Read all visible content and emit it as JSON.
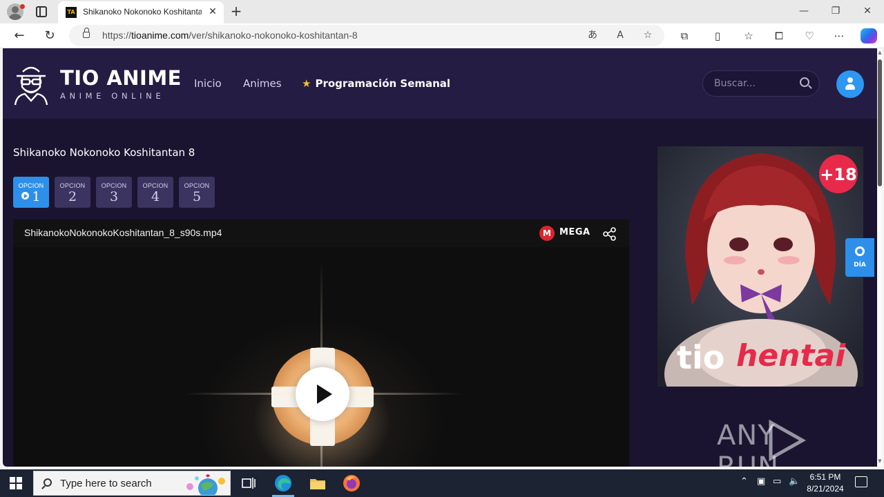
{
  "browser": {
    "tab_title": "Shikanoko Nokonoko Koshitantan",
    "tab_favicon_text": "TA",
    "url_prefix": "https://",
    "url_host": "tioanime.com",
    "url_path": "/ver/shikanoko-nokonoko-koshitantan-8"
  },
  "site": {
    "brand": "TIO ANIME",
    "tagline": "ANIME ONLINE",
    "nav": [
      {
        "label": "Inicio"
      },
      {
        "label": "Animes"
      },
      {
        "label": "Programación Semanal"
      }
    ],
    "search_placeholder": "Buscar..."
  },
  "episode": {
    "title": "Shikanoko Nokonoko Koshitantan 8",
    "options": [
      {
        "label": "OPCION",
        "number": "1",
        "active": true
      },
      {
        "label": "OPCION",
        "number": "2",
        "active": false
      },
      {
        "label": "OPCION",
        "number": "3",
        "active": false
      },
      {
        "label": "OPCION",
        "number": "4",
        "active": false
      },
      {
        "label": "OPCION",
        "number": "5",
        "active": false
      }
    ]
  },
  "player": {
    "file_name": "ShikanokoNokonokoKoshitantan_8_s90s.mp4",
    "host_logo_letter": "M",
    "host_name": "MEGA"
  },
  "ad": {
    "badge": "+18",
    "brand_part1": "tio",
    "brand_part2": "hentai"
  },
  "theme_toggle": {
    "label": "DÍA"
  },
  "watermark": {
    "part1": "ANY",
    "part2": "RUN"
  },
  "taskbar": {
    "search_placeholder": "Type here to search",
    "time": "6:51 PM",
    "date": "8/21/2024"
  },
  "colors": {
    "page_bg": "#1a1430",
    "header_bg": "#241c42",
    "accent_blue": "#2e8fea",
    "option_bg": "#3b3360",
    "mega_red": "#d9272e"
  }
}
